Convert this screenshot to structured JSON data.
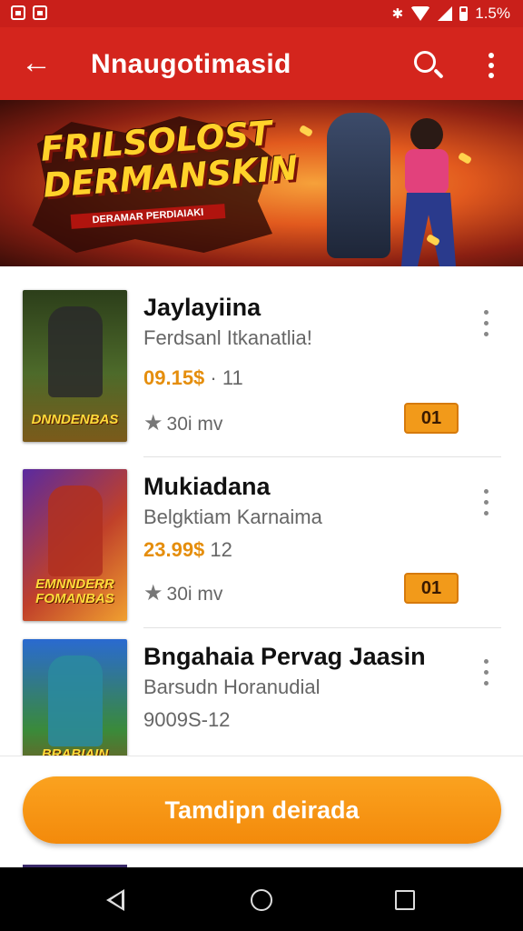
{
  "status_bar": {
    "left_icons": [
      "notification-icon",
      "notification-icon"
    ],
    "right_icons": [
      "bluetooth-icon",
      "wifi-icon",
      "signal-icon",
      "battery-icon"
    ],
    "battery_text": "1.5%"
  },
  "app_bar": {
    "back_icon": "arrow-left-icon",
    "title": "Nnaugotimasid",
    "actions": [
      "search-icon",
      "more-vert-icon"
    ],
    "color": "#d4251d"
  },
  "banner": {
    "title": "FRILSOLOST DERMANSKIN",
    "subtitle": "DERAMAR PERDIAIAKI"
  },
  "games": [
    {
      "title": "Jaylayiina",
      "subtitle": "Ferdsanl Itkanatlia!",
      "price": "09.15$",
      "price_suffix": "· 11",
      "rating": "30i mv",
      "button": "01",
      "thumb_label": "DNNDENBAS"
    },
    {
      "title": "Mukiadana",
      "subtitle": "Belgktiam Karnaima",
      "price": "23.99$",
      "price_suffix": "12",
      "rating": "30i mv",
      "button": "01",
      "thumb_label": "EMNNDERR FOMANBAS"
    },
    {
      "title": "Bngahaia Pervag Jaasin",
      "subtitle": "Barsudn Horanudial",
      "price": "",
      "price_suffix": "9009S-12",
      "rating": "",
      "button": "",
      "thumb_label": "BRABIAIN EFLNDENS"
    }
  ],
  "cta": {
    "label": "Tamdipn deirada",
    "color": "#f7941d"
  },
  "nav_bar": {
    "buttons": [
      "back-triangle-icon",
      "home-circle-icon",
      "recents-square-icon"
    ]
  }
}
